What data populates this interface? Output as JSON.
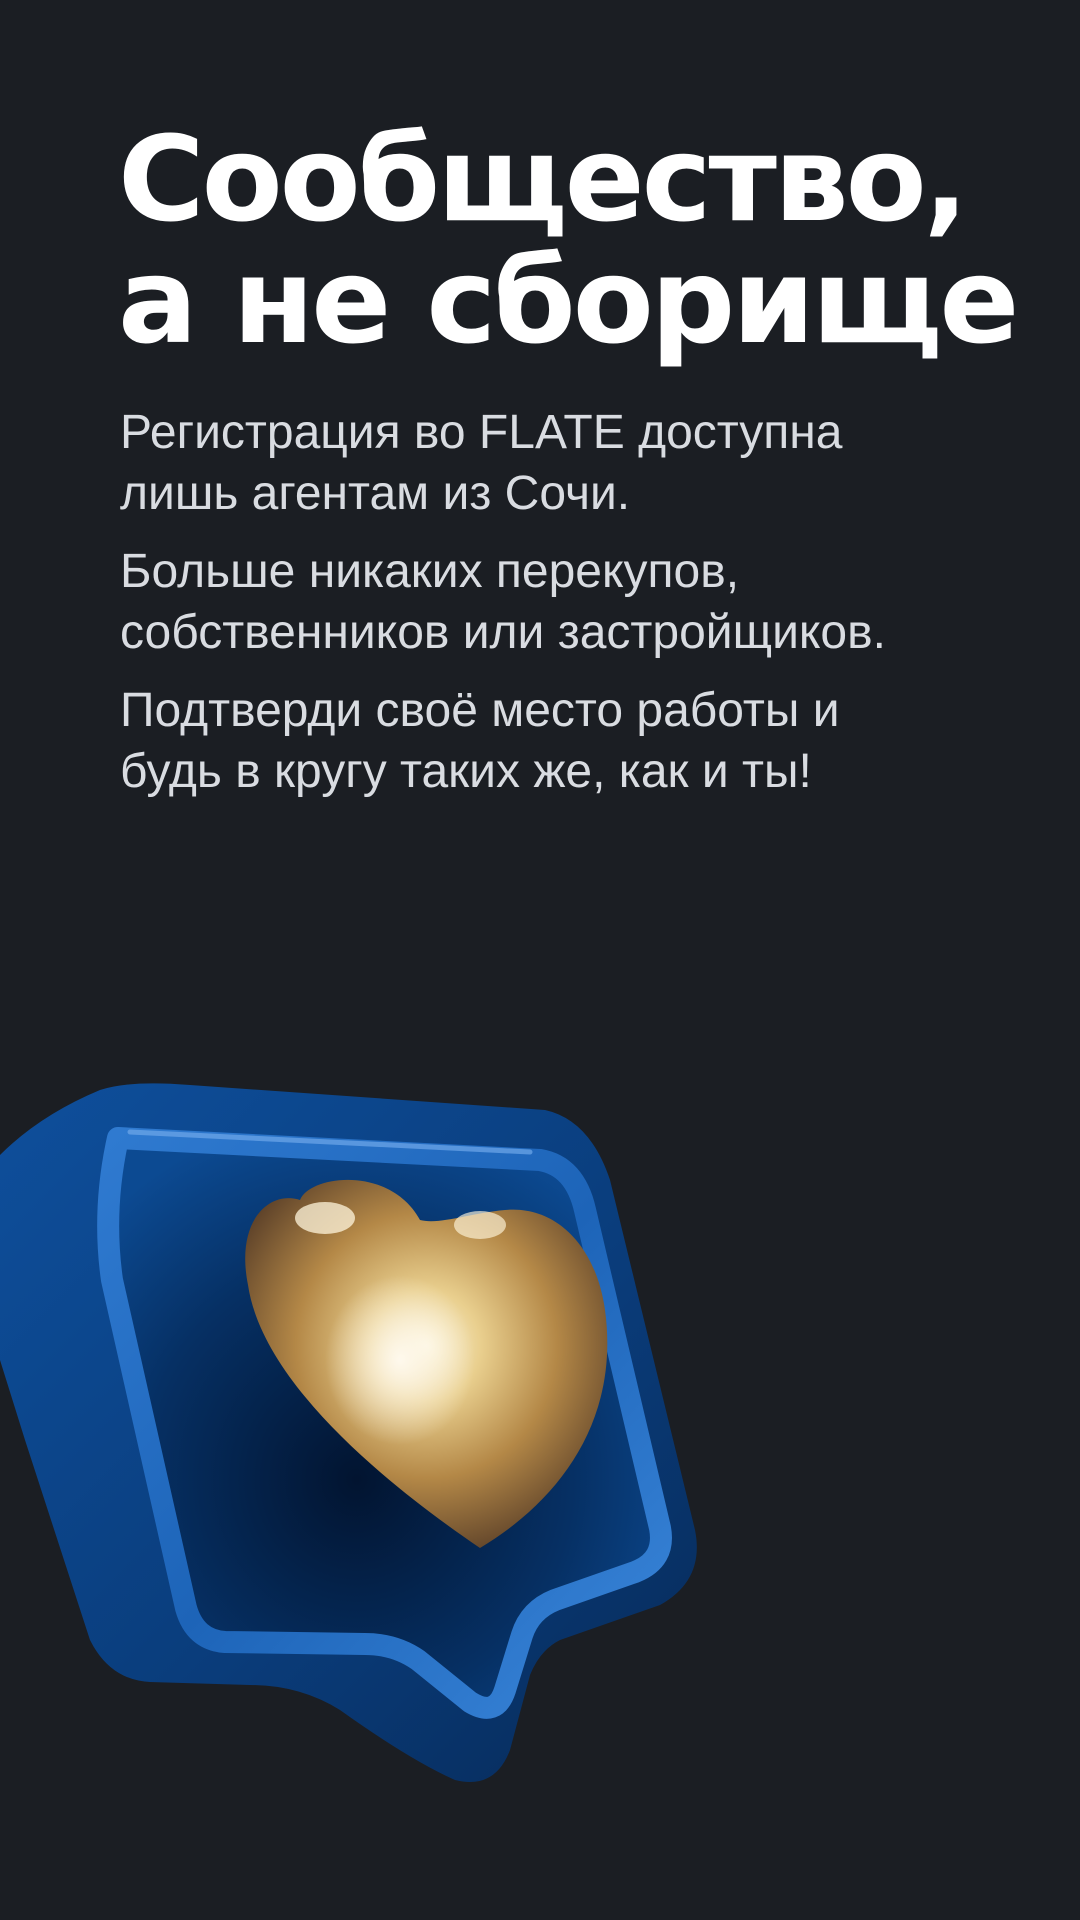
{
  "headline": {
    "line1": "Сообщество,",
    "line2": "а не сборище"
  },
  "paragraphs": [
    {
      "line1": "Регистрация во FLATE доступна",
      "line2": "лишь агентам из Сочи."
    },
    {
      "line1": "Больше никаких перекупов,",
      "line2": "собственников или застройщиков."
    },
    {
      "line1": "Подтверди своё место работы и",
      "line2": "будь в кругу таких же, как и ты!"
    }
  ],
  "illustration": {
    "icon": "speech-bubble-heart-icon",
    "colors": {
      "background": "#1b1e23",
      "bubble": "#0d4a94",
      "heart": "#c9a15a"
    }
  }
}
